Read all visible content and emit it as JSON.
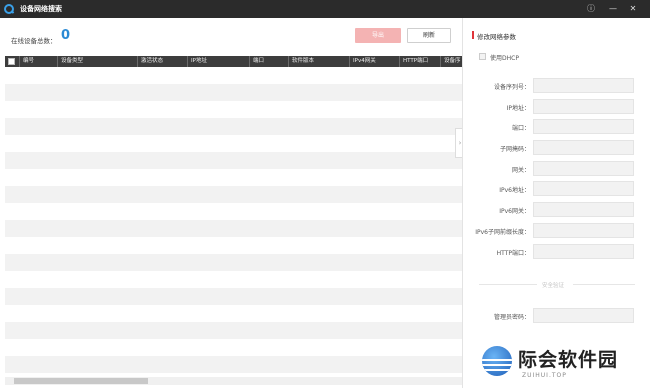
{
  "window": {
    "title": "设备网络搜索",
    "info_icon": "info-icon",
    "minimize_icon": "minimize-icon",
    "close_icon": "close-icon"
  },
  "toolbar": {
    "online_label": "在线设备总数：",
    "online_count": "0",
    "export_label": "导出",
    "refresh_label": "刷新"
  },
  "table": {
    "columns": [
      "编号",
      "设备类型",
      "激活状态",
      "IP地址",
      "端口",
      "软件版本",
      "IPv4网关",
      "HTTP端口",
      "设备序"
    ]
  },
  "panel": {
    "title": "修改网络参数",
    "dhcp_label": "使用DHCP",
    "fields": [
      {
        "label": "设备序列号："
      },
      {
        "label": "IP地址："
      },
      {
        "label": "端口："
      },
      {
        "label": "子网掩码："
      },
      {
        "label": "网关："
      },
      {
        "label": "IPv6地址："
      },
      {
        "label": "IPv6网关："
      },
      {
        "label": "IPv6子网前缀长度："
      },
      {
        "label": "HTTP端口："
      }
    ],
    "security_section": "安全验证",
    "admin_password_label": "管理员密码："
  },
  "watermark": {
    "title": "际会软件园",
    "subtitle": "ZUIHUI.TOP"
  }
}
